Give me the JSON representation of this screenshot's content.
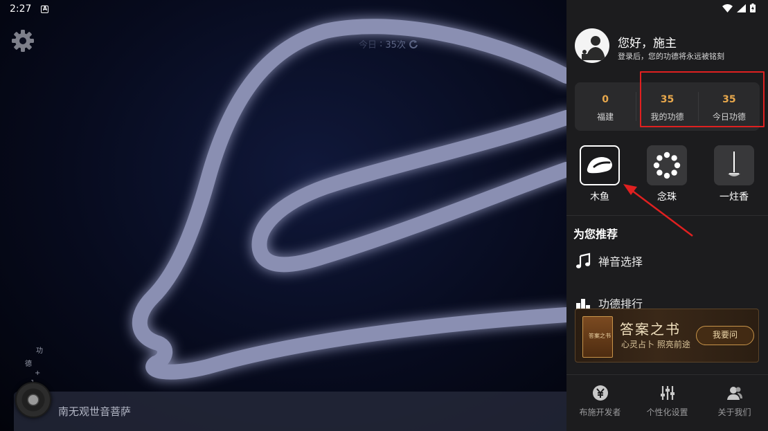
{
  "status_bar": {
    "time": "2:27",
    "icons": [
      "a-notification-icon",
      "wifi-icon",
      "signal-icon",
      "battery-icon"
    ]
  },
  "stage": {
    "counter_label": "今日",
    "counter_value": "35次",
    "floating_chars": [
      "功",
      "德",
      "+",
      "1"
    ],
    "now_playing": "南无观世音菩萨",
    "icons": [
      "gear-icon",
      "refresh-icon",
      "wooden-fish-icon",
      "record-disc-icon"
    ]
  },
  "panel": {
    "greeting": "您好，施主",
    "greeting_sub": "登录后，您的功德将永远被铭刻",
    "stats": [
      {
        "value": "0",
        "label": "福建"
      },
      {
        "value": "35",
        "label": "我的功德"
      },
      {
        "value": "35",
        "label": "今日功德"
      }
    ],
    "tools": [
      {
        "label": "木鱼",
        "icon": "wooden-fish-icon"
      },
      {
        "label": "念珠",
        "icon": "prayer-beads-icon"
      },
      {
        "label": "一炷香",
        "icon": "incense-icon"
      }
    ],
    "recommend_title": "为您推荐",
    "recommend_items": [
      {
        "label": "禅音选择",
        "icon": "music-note-icon"
      },
      {
        "label": "功德排行",
        "icon": "ranking-icon"
      }
    ],
    "banner": {
      "book_title": "答案之书",
      "title": "答案之书",
      "subtitle": "心灵占卜 照亮前途",
      "button": "我要问"
    },
    "bottom_nav": [
      {
        "label": "布施开发者",
        "icon": "yen-icon"
      },
      {
        "label": "个性化设置",
        "icon": "sliders-icon"
      },
      {
        "label": "关于我们",
        "icon": "people-icon"
      }
    ]
  },
  "colors": {
    "accent": "#e8a84c",
    "annotation_red": "#e02020",
    "panel_bg": "#1c1c1e",
    "glow": "#7e86b8"
  }
}
